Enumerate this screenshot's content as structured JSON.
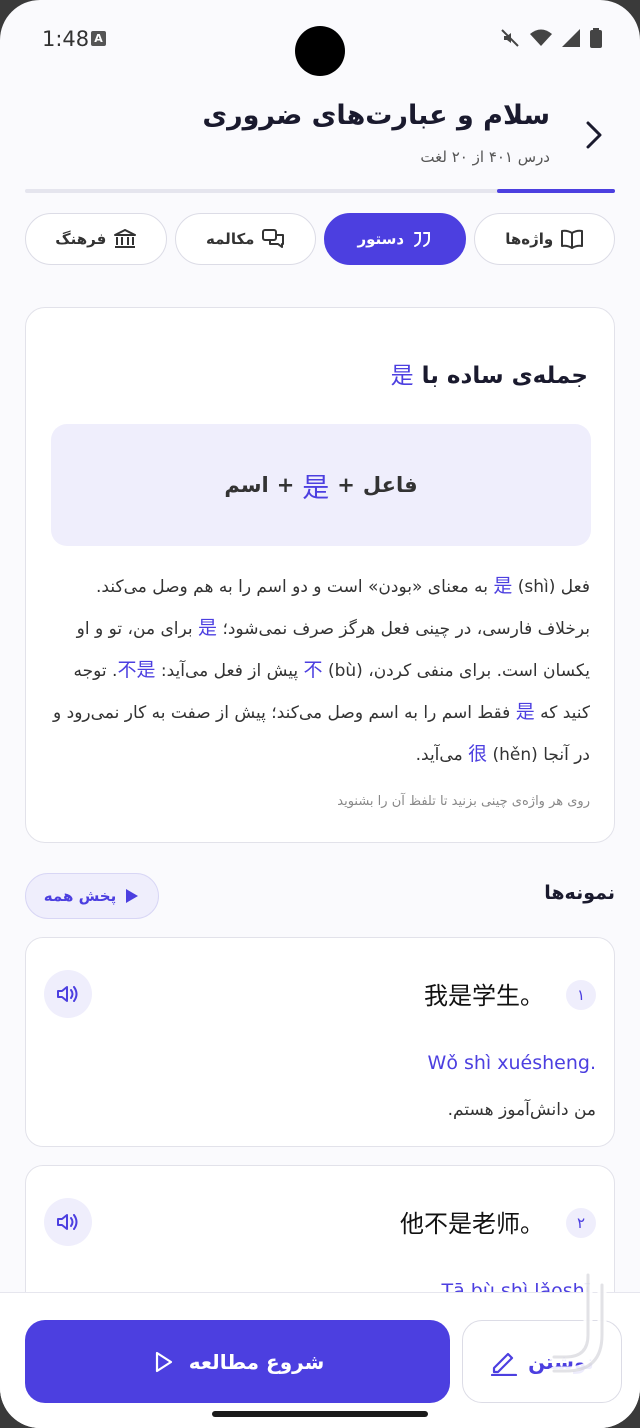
{
  "status": {
    "time": "1:48",
    "badge": "A"
  },
  "header": {
    "title": "سلام و عبارت‌های ضروری",
    "subtitle": "درس ۴۰۱ از ۲۰ لغت",
    "progress": 0.2
  },
  "tabs": [
    {
      "label": "واژه‌ها",
      "icon": "book-icon",
      "active": false
    },
    {
      "label": "دستور",
      "icon": "quote-icon",
      "active": true
    },
    {
      "label": "مکالمه",
      "icon": "chat-icon",
      "active": false
    },
    {
      "label": "فرهنگ",
      "icon": "museum-icon",
      "active": false
    }
  ],
  "grammar": {
    "title_prefix": "جمله‌ی ساده با",
    "title_char": "是",
    "formula": {
      "subject": "فاعل",
      "plus1": "+",
      "char": "是",
      "plus2": "+",
      "noun": "اسم"
    },
    "body": {
      "p1": "فعل",
      "c1": "是",
      "p2": "(shì) به معنای «بودن» است و دو اسم را به هم وصل می‌کند. برخلاف فارسی، در چینی فعل هرگز صرف نمی‌شود؛",
      "c2": "是",
      "p3": "برای من، تو و او یکسان است. برای منفی کردن،",
      "c3": "不",
      "p4": "(bù) پیش از فعل می‌آید:",
      "c4": "不是",
      "p5": ". توجه کنید که",
      "c5": "是",
      "p6": "فقط اسم را به اسم وصل می‌کند؛ پیش از صفت به کار نمی‌رود و در آنجا",
      "c6": "很",
      "p7": "(hěn) می‌آید."
    },
    "hint": "روی هر واژه‌ی چینی بزنید تا تلفظ آن را بشنوید"
  },
  "examples": {
    "title": "نمونه‌ها",
    "play_all": "پخش همه",
    "items": [
      {
        "num": "۱",
        "zh": "我是学生。",
        "pinyin": "Wǒ shì xuésheng.",
        "fa": "من دانش‌آموز هستم."
      },
      {
        "num": "۲",
        "zh": "他不是老师。",
        "pinyin": "Tā bù shì lǎoshī.",
        "fa": ""
      }
    ]
  },
  "bottom": {
    "start_label": "شروع مطالعه",
    "write_label": "نوشتن"
  },
  "colors": {
    "accent": "#4c3fe0",
    "accent_soft": "#efeefc"
  }
}
